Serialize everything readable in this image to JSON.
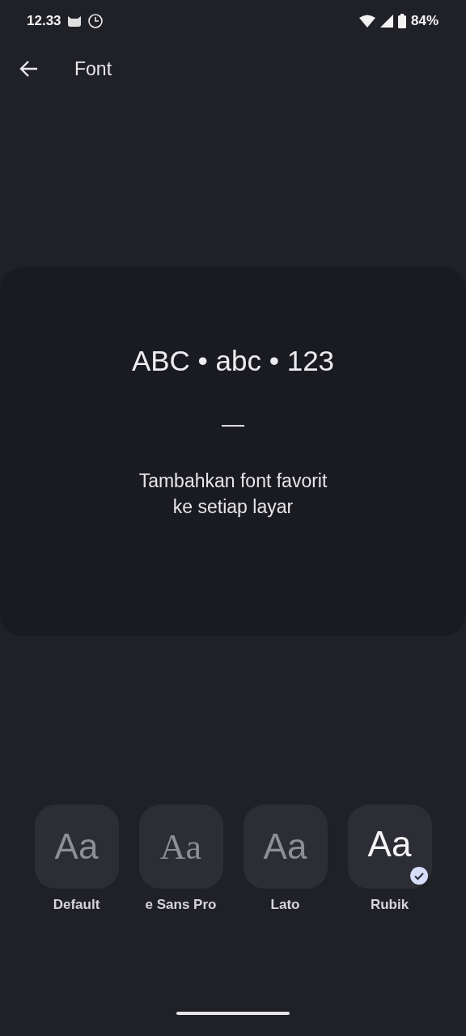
{
  "status_bar": {
    "time": "12.33",
    "battery": "84%"
  },
  "header": {
    "title": "Font"
  },
  "preview": {
    "sample": "ABC • abc • 123",
    "separator": "—",
    "caption": "Tambahkan font favorit\nke setiap layar"
  },
  "fonts": [
    {
      "sample": "Aa",
      "label": "Default",
      "kind": "sans",
      "selected": false
    },
    {
      "sample": "Aa",
      "label": "e Sans Pro",
      "kind": "serif",
      "selected": false
    },
    {
      "sample": "Aa",
      "label": "Lato",
      "kind": "sans",
      "selected": false
    },
    {
      "sample": "Aa",
      "label": "Rubik",
      "kind": "sans",
      "selected": true
    }
  ]
}
